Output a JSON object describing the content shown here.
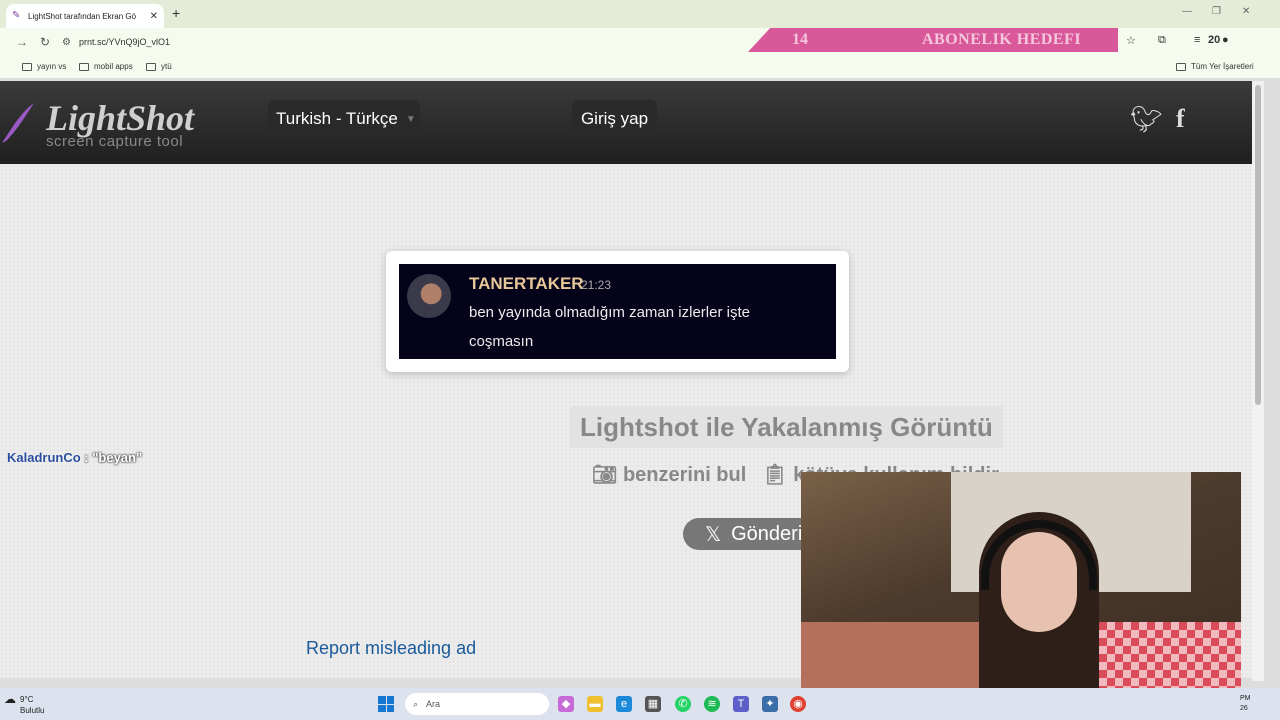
{
  "browser": {
    "tab_title": "LightShot tarafından Ekran Gö",
    "tab_close": "✕",
    "new_tab": "+",
    "url": "prnt.sc/YVnQ9jO_vlO1",
    "bookmarks": [
      "yayın vs",
      "mobil apps",
      "ytü"
    ],
    "all_bookmarks": "Tüm Yer İşaretleri"
  },
  "stream_overlay": {
    "count": "14",
    "label": "ABONELIK HEDEFI",
    "goal": "20"
  },
  "lightshot": {
    "logo_name": "LightShot",
    "logo_sub": "screen capture tool",
    "language": "Turkish - Türkçe",
    "login": "Giriş yap"
  },
  "screenshot": {
    "username": "TANERTAKER",
    "time": "21:23",
    "message": "ben yayında olmadığım zaman izlerler işte coşmasın"
  },
  "page": {
    "caption": "Lightshot ile Yakalanmış Görüntü",
    "find_similar": "benzerini bul",
    "report_abuse": "kötüye kullanım bildir",
    "tweet": "Gönderi",
    "report_ad": "Report misleading ad"
  },
  "chat": {
    "user": "KaladrunCo",
    "text": ": \"beyan\""
  },
  "taskbar": {
    "temp": "9°C",
    "weather": "Bulutlu",
    "search_placeholder": "Ara",
    "clock_top": "PM",
    "clock_bottom": "26"
  },
  "colors": {
    "accent_pink": "#d9589a",
    "link_blue": "#1a5a9a",
    "username_gold": "#e8c79a"
  }
}
